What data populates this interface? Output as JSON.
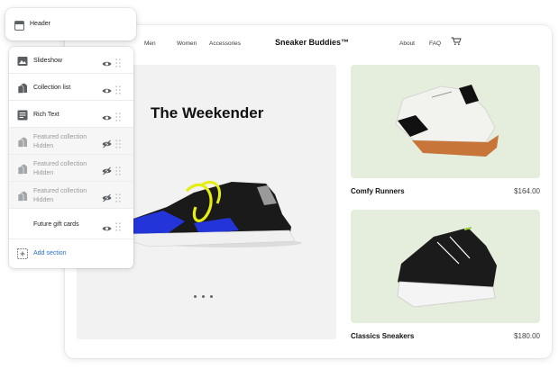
{
  "header_card": {
    "label": "Header",
    "icon": "header-layout-icon"
  },
  "sections": [
    {
      "label": "Slideshow",
      "icon": "slideshow-icon",
      "visibility": "visible"
    },
    {
      "label": "Collection list",
      "icon": "collection-icon",
      "visibility": "visible"
    },
    {
      "label": "Rich Text",
      "icon": "text-block-icon",
      "visibility": "visible"
    },
    {
      "label": "Featured collection",
      "status": "Hidden",
      "icon": "collection-icon",
      "visibility": "hidden"
    },
    {
      "label": "Featured collection",
      "status": "Hidden",
      "icon": "collection-icon",
      "visibility": "hidden"
    },
    {
      "label": "Featured collection",
      "status": "Hidden",
      "icon": "collection-icon",
      "visibility": "hidden"
    },
    {
      "label": "Future gift cards",
      "icon": "",
      "visibility": "visible"
    }
  ],
  "add_section": {
    "label": "Add section",
    "icon": "add-section-icon"
  },
  "store": {
    "nav": {
      "men": "Men",
      "women": "Women",
      "accessories": "Accessories",
      "about": "About",
      "faq": "FAQ"
    },
    "brand": "Sneaker Buddies™",
    "cart_icon": "cart-icon",
    "hero": {
      "title": "The Weekender",
      "slide_count": 3
    },
    "products": [
      {
        "name": "Comfy Runners",
        "price": "$164.00"
      },
      {
        "name": "Classics Sneakers",
        "price": "$180.00"
      }
    ]
  },
  "colors": {
    "link": "#2c6ecb",
    "hidden_row_bg": "#f6f6f7",
    "product_bg": "#e5eddd"
  }
}
